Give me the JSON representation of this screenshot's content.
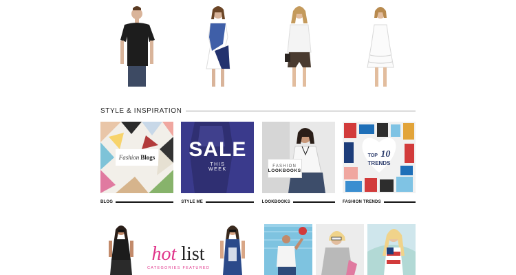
{
  "products": [
    {
      "name": "black-tshirt"
    },
    {
      "name": "blue-colorblock-dress"
    },
    {
      "name": "white-top-leather-shorts"
    },
    {
      "name": "white-lace-dress"
    }
  ],
  "section": {
    "title": "STYLE & INSPIRATION"
  },
  "tiles": [
    {
      "caption": "BLOG",
      "overlay_line1": "Fashion",
      "overlay_line2": "Blogs"
    },
    {
      "caption": "STYLE ME",
      "overlay_line1": "SALE",
      "overlay_line2": "THIS",
      "overlay_line3": "WEEK"
    },
    {
      "caption": "LOOKBOOKS",
      "overlay_line1": "FASHION",
      "overlay_line2": "LOOKBOOKS"
    },
    {
      "caption": "FASHION TRENDS",
      "overlay_line1": "TOP",
      "overlay_line2": "10",
      "overlay_line3": "TRENDS"
    }
  ],
  "promo": {
    "hot": "hot",
    "list": "list",
    "sub": "CATEGORIES FEATURED"
  },
  "colors": {
    "accent_pink": "#e0348a",
    "sale_bg": "#3a3a8c",
    "rule": "#9a9a9a"
  }
}
